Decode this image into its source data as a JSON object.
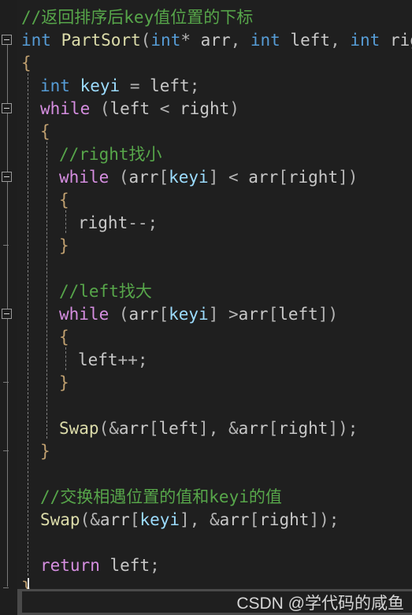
{
  "editor": {
    "theme": "visual-studio-dark",
    "background_color": "#1e1e1e",
    "language": "C/C++",
    "colors": {
      "comment": "#57a64a",
      "keyword": "#569cd6",
      "control_keyword": "#d58ee0",
      "function": "#dcdcaa",
      "local_variable": "#9cdcfe",
      "identifier": "#c8c8c8",
      "punctuation": "#b4b4b4",
      "brace": "#c0a070",
      "fold_margin_line": "#7a7a7a",
      "indent_guide": "#808080",
      "watermark_bar": "#4a4a4a",
      "watermark_text": "#d6d6d6"
    }
  },
  "code": {
    "lines": [
      {
        "n": 1,
        "indent": 0,
        "tokens": [
          {
            "t": "//返回排序后key值位置的下标",
            "c": "tok-cmt"
          }
        ]
      },
      {
        "n": 2,
        "indent": 0,
        "tokens": [
          {
            "t": "int",
            "c": "tok-kw"
          },
          {
            "t": " ",
            "c": "tok-id"
          },
          {
            "t": "PartSort",
            "c": "tok-fn"
          },
          {
            "t": "(",
            "c": "tok-pun"
          },
          {
            "t": "int",
            "c": "tok-kw"
          },
          {
            "t": "*",
            "c": "tok-pun"
          },
          {
            "t": " ",
            "c": "tok-id"
          },
          {
            "t": "arr",
            "c": "tok-id"
          },
          {
            "t": ", ",
            "c": "tok-pun"
          },
          {
            "t": "int",
            "c": "tok-kw"
          },
          {
            "t": " ",
            "c": "tok-id"
          },
          {
            "t": "left",
            "c": "tok-id"
          },
          {
            "t": ", ",
            "c": "tok-pun"
          },
          {
            "t": "int",
            "c": "tok-kw"
          },
          {
            "t": " ",
            "c": "tok-id"
          },
          {
            "t": "right",
            "c": "tok-id"
          },
          {
            "t": ")",
            "c": "tok-pun"
          }
        ]
      },
      {
        "n": 3,
        "indent": 0,
        "tokens": [
          {
            "t": "{",
            "c": "tok-brc"
          }
        ]
      },
      {
        "n": 4,
        "indent": 1,
        "tokens": [
          {
            "t": "int",
            "c": "tok-kw"
          },
          {
            "t": " ",
            "c": "tok-id"
          },
          {
            "t": "keyi",
            "c": "tok-var"
          },
          {
            "t": " = ",
            "c": "tok-pun"
          },
          {
            "t": "left",
            "c": "tok-id"
          },
          {
            "t": ";",
            "c": "tok-pun"
          }
        ]
      },
      {
        "n": 5,
        "indent": 1,
        "tokens": [
          {
            "t": "while",
            "c": "tok-ctl"
          },
          {
            "t": " (",
            "c": "tok-pun"
          },
          {
            "t": "left",
            "c": "tok-id"
          },
          {
            "t": " < ",
            "c": "tok-pun"
          },
          {
            "t": "right",
            "c": "tok-id"
          },
          {
            "t": ")",
            "c": "tok-pun"
          }
        ]
      },
      {
        "n": 6,
        "indent": 1,
        "tokens": [
          {
            "t": "{",
            "c": "tok-brc"
          }
        ]
      },
      {
        "n": 7,
        "indent": 2,
        "tokens": [
          {
            "t": "//right找小",
            "c": "tok-cmt"
          }
        ]
      },
      {
        "n": 8,
        "indent": 2,
        "tokens": [
          {
            "t": "while",
            "c": "tok-ctl"
          },
          {
            "t": " (",
            "c": "tok-pun"
          },
          {
            "t": "arr",
            "c": "tok-id"
          },
          {
            "t": "[",
            "c": "tok-pun"
          },
          {
            "t": "keyi",
            "c": "tok-var"
          },
          {
            "t": "]",
            "c": "tok-pun"
          },
          {
            "t": " < ",
            "c": "tok-pun"
          },
          {
            "t": "arr",
            "c": "tok-id"
          },
          {
            "t": "[",
            "c": "tok-pun"
          },
          {
            "t": "right",
            "c": "tok-id"
          },
          {
            "t": "])",
            "c": "tok-pun"
          }
        ]
      },
      {
        "n": 9,
        "indent": 2,
        "tokens": [
          {
            "t": "{",
            "c": "tok-brc"
          }
        ]
      },
      {
        "n": 10,
        "indent": 3,
        "tokens": [
          {
            "t": "right",
            "c": "tok-id"
          },
          {
            "t": "--;",
            "c": "tok-pun"
          }
        ]
      },
      {
        "n": 11,
        "indent": 2,
        "tokens": [
          {
            "t": "}",
            "c": "tok-brc"
          }
        ]
      },
      {
        "n": 12,
        "indent": 0,
        "tokens": []
      },
      {
        "n": 13,
        "indent": 2,
        "tokens": [
          {
            "t": "//left找大",
            "c": "tok-cmt"
          }
        ]
      },
      {
        "n": 14,
        "indent": 2,
        "tokens": [
          {
            "t": "while",
            "c": "tok-ctl"
          },
          {
            "t": " (",
            "c": "tok-pun"
          },
          {
            "t": "arr",
            "c": "tok-id"
          },
          {
            "t": "[",
            "c": "tok-pun"
          },
          {
            "t": "keyi",
            "c": "tok-var"
          },
          {
            "t": "]",
            "c": "tok-pun"
          },
          {
            "t": " >",
            "c": "tok-pun"
          },
          {
            "t": "arr",
            "c": "tok-id"
          },
          {
            "t": "[",
            "c": "tok-pun"
          },
          {
            "t": "left",
            "c": "tok-id"
          },
          {
            "t": "])",
            "c": "tok-pun"
          }
        ]
      },
      {
        "n": 15,
        "indent": 2,
        "tokens": [
          {
            "t": "{",
            "c": "tok-brc"
          }
        ]
      },
      {
        "n": 16,
        "indent": 3,
        "tokens": [
          {
            "t": "left",
            "c": "tok-id"
          },
          {
            "t": "++;",
            "c": "tok-pun"
          }
        ]
      },
      {
        "n": 17,
        "indent": 2,
        "tokens": [
          {
            "t": "}",
            "c": "tok-brc"
          }
        ]
      },
      {
        "n": 18,
        "indent": 0,
        "tokens": []
      },
      {
        "n": 19,
        "indent": 2,
        "tokens": [
          {
            "t": "Swap",
            "c": "tok-fn"
          },
          {
            "t": "(&",
            "c": "tok-pun"
          },
          {
            "t": "arr",
            "c": "tok-id"
          },
          {
            "t": "[",
            "c": "tok-pun"
          },
          {
            "t": "left",
            "c": "tok-id"
          },
          {
            "t": "], &",
            "c": "tok-pun"
          },
          {
            "t": "arr",
            "c": "tok-id"
          },
          {
            "t": "[",
            "c": "tok-pun"
          },
          {
            "t": "right",
            "c": "tok-id"
          },
          {
            "t": "]);",
            "c": "tok-pun"
          }
        ]
      },
      {
        "n": 20,
        "indent": 1,
        "tokens": [
          {
            "t": "}",
            "c": "tok-brc"
          }
        ]
      },
      {
        "n": 21,
        "indent": 0,
        "tokens": []
      },
      {
        "n": 22,
        "indent": 1,
        "tokens": [
          {
            "t": "//交换相遇位置的值和keyi的值",
            "c": "tok-cmt"
          }
        ]
      },
      {
        "n": 23,
        "indent": 1,
        "tokens": [
          {
            "t": "Swap",
            "c": "tok-fn"
          },
          {
            "t": "(&",
            "c": "tok-pun"
          },
          {
            "t": "arr",
            "c": "tok-id"
          },
          {
            "t": "[",
            "c": "tok-pun"
          },
          {
            "t": "keyi",
            "c": "tok-var"
          },
          {
            "t": "], &",
            "c": "tok-pun"
          },
          {
            "t": "arr",
            "c": "tok-id"
          },
          {
            "t": "[",
            "c": "tok-pun"
          },
          {
            "t": "right",
            "c": "tok-id"
          },
          {
            "t": "]);",
            "c": "tok-pun"
          }
        ]
      },
      {
        "n": 24,
        "indent": 0,
        "tokens": []
      },
      {
        "n": 25,
        "indent": 1,
        "tokens": [
          {
            "t": "return",
            "c": "tok-ctl"
          },
          {
            "t": " ",
            "c": "tok-id"
          },
          {
            "t": "left",
            "c": "tok-id"
          },
          {
            "t": ";",
            "c": "tok-pun"
          }
        ]
      },
      {
        "n": 26,
        "indent": 0,
        "tokens": [
          {
            "t": "}",
            "c": "tok-brc"
          }
        ]
      }
    ]
  },
  "fold_margin": {
    "boxes": [
      {
        "name": "fold-box-partsort",
        "line": 2
      },
      {
        "name": "fold-box-while-outer",
        "line": 5
      },
      {
        "name": "fold-box-while-right",
        "line": 8
      },
      {
        "name": "fold-box-while-left",
        "line": 14
      }
    ],
    "scopes": [
      {
        "name": "fold-scope-partsort",
        "from": 2,
        "to": 26
      },
      {
        "name": "fold-scope-while-outer",
        "from": 5,
        "to": 20
      },
      {
        "name": "fold-scope-while-right",
        "from": 8,
        "to": 11
      },
      {
        "name": "fold-scope-while-left",
        "from": 14,
        "to": 17
      }
    ]
  },
  "caret": {
    "line": 26,
    "column": 1
  },
  "watermark": {
    "text": "CSDN @学代码的咸鱼"
  }
}
